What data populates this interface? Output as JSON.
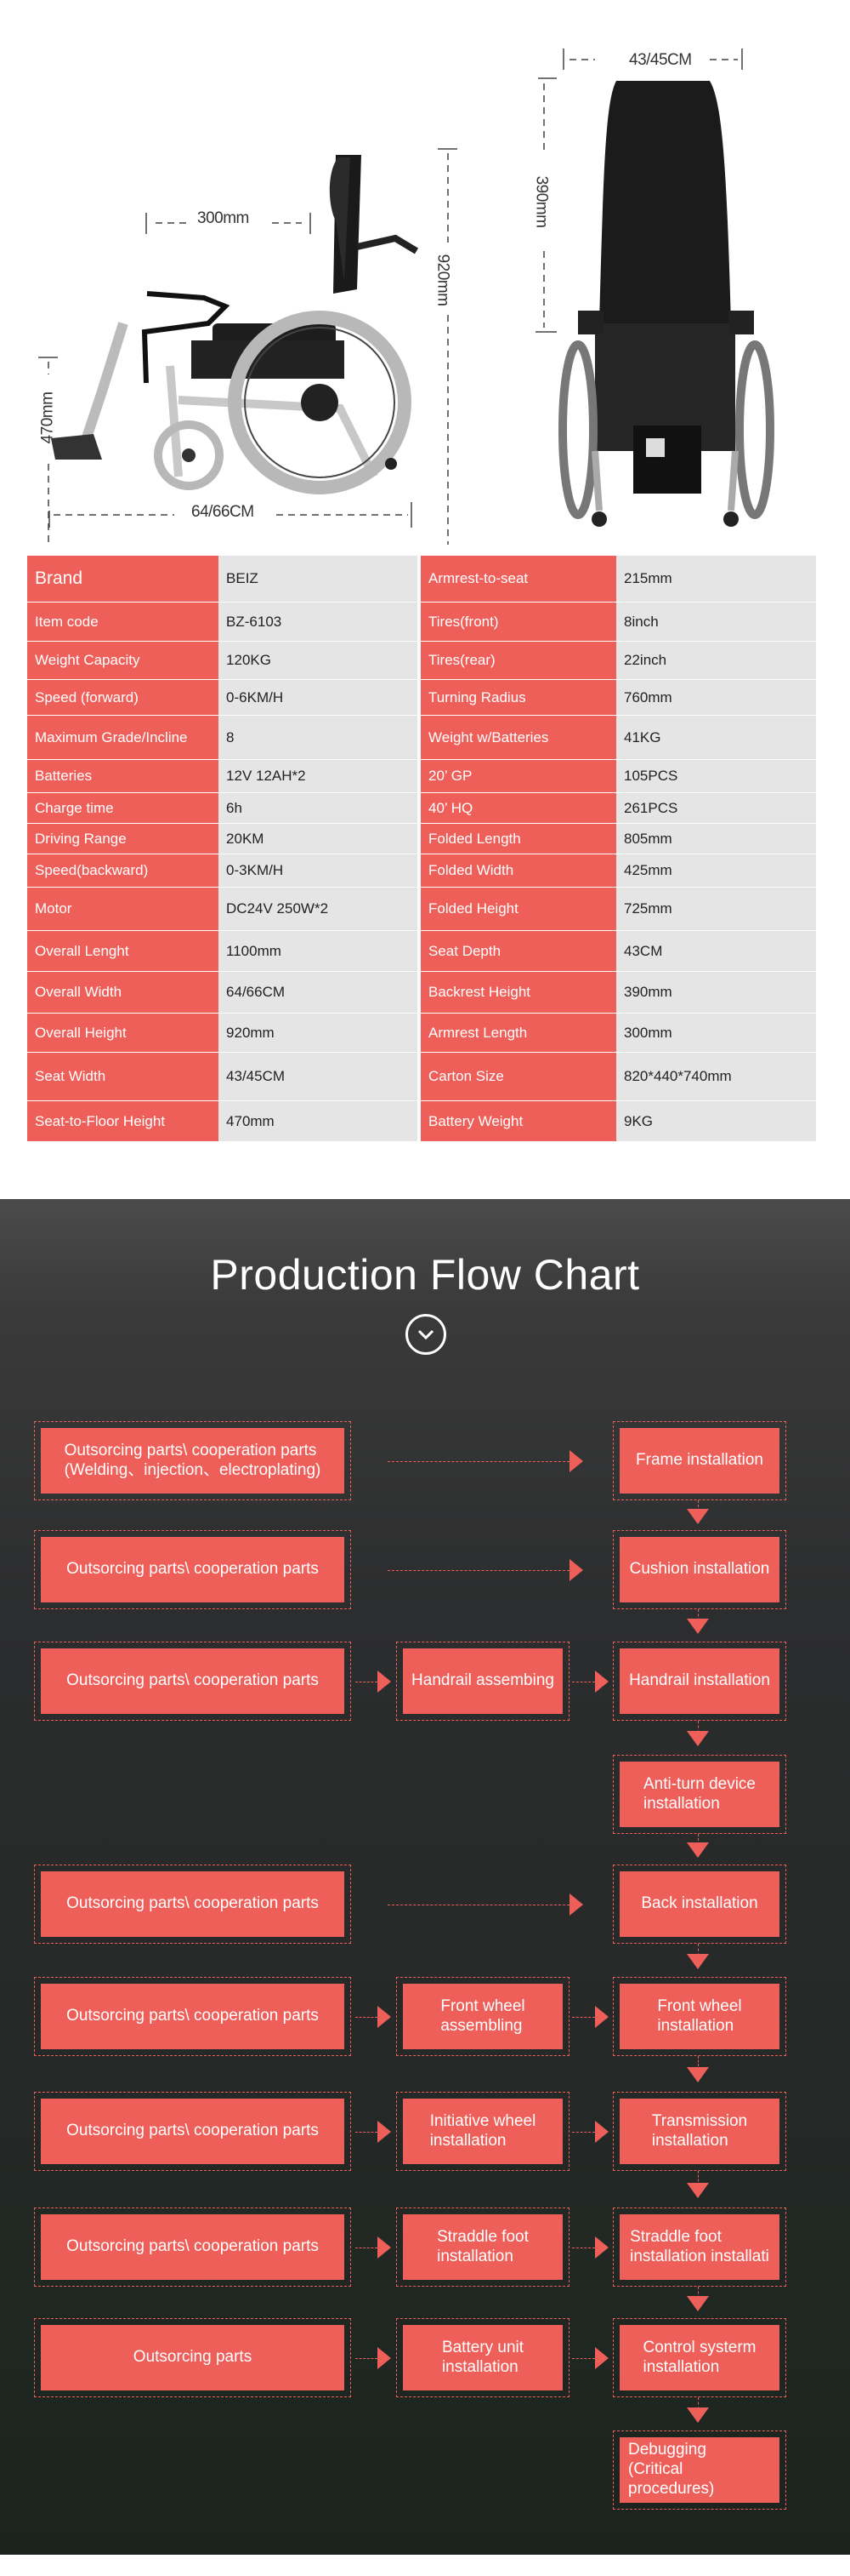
{
  "dimensions": {
    "armrest_length": "300mm",
    "overall_height": "920mm",
    "seat_floor": "470mm",
    "overall_width": "64/66CM",
    "seat_width": "43/45CM",
    "backrest_height": "390mm"
  },
  "specs": [
    [
      "Brand",
      "BEIZ",
      "Armrest-to-seat",
      "215mm"
    ],
    [
      "Item code",
      "BZ-6103",
      "Tires(front)",
      "8inch"
    ],
    [
      "Weight Capacity",
      "120KG",
      "Tires(rear)",
      "22inch"
    ],
    [
      "Speed (forward)",
      "0-6KM/H",
      "Turning Radius",
      "760mm"
    ],
    [
      "Maximum Grade/Incline",
      "8",
      "Weight w/Batteries",
      "41KG"
    ],
    [
      "Batteries",
      "12V 12AH*2",
      "20’ GP",
      "105PCS"
    ],
    [
      "Charge time",
      "6h",
      "40’ HQ",
      "261PCS"
    ],
    [
      "Driving Range",
      "20KM",
      "Folded Length",
      "805mm"
    ],
    [
      "Speed(backward)",
      "0-3KM/H",
      "Folded Width",
      "425mm"
    ],
    [
      "Motor",
      "DC24V 250W*2",
      "Folded Height",
      "725mm"
    ],
    [
      "Overall Lenght",
      "1100mm",
      "Seat Depth",
      "43CM"
    ],
    [
      "Overall Width",
      "64/66CM",
      "Backrest Height",
      "390mm"
    ],
    [
      "Overall Height",
      "920mm",
      "Armrest Length",
      "300mm"
    ],
    [
      "Seat  Width",
      "43/45CM",
      "Carton Size",
      "820*440*740mm"
    ],
    [
      "Seat-to-Floor Height",
      "470mm",
      "Battery Weight",
      "9KG"
    ]
  ],
  "flow": {
    "title": "Production Flow Chart",
    "icon": "chevron-down-circle-icon",
    "accent": "#ef5f5a",
    "rows": [
      {
        "left": "Outsorcing parts\\ cooperation parts\n(Welding、injection、electroplating)",
        "mid": null,
        "right": "Frame installation"
      },
      {
        "left": "Outsorcing parts\\ cooperation parts",
        "mid": null,
        "right": "Cushion installation"
      },
      {
        "left": "Outsorcing parts\\ cooperation parts",
        "mid": "Handrail assembing",
        "right": "Handrail installation"
      },
      {
        "left": null,
        "mid": null,
        "right": "Anti-turn device\ninstallation"
      },
      {
        "left": "Outsorcing parts\\ cooperation parts",
        "mid": null,
        "right": "Back installation"
      },
      {
        "left": "Outsorcing parts\\ cooperation parts",
        "mid": "Front wheel\nassembling",
        "right": "Front wheel\ninstallation"
      },
      {
        "left": "Outsorcing parts\\ cooperation parts",
        "mid": "Initiative wheel\ninstallation",
        "right": "Transmission\ninstallation"
      },
      {
        "left": "Outsorcing parts\\ cooperation parts",
        "mid": "Straddle foot\ninstallation",
        "right": "Straddle foot\ninstallation installati"
      },
      {
        "left": "Outsorcing parts",
        "mid": "Battery unit\ninstallation",
        "right": "Control systerm\ninstallation"
      },
      {
        "left": null,
        "mid": null,
        "right": "Debugging\n(Critical procedures)"
      }
    ]
  }
}
